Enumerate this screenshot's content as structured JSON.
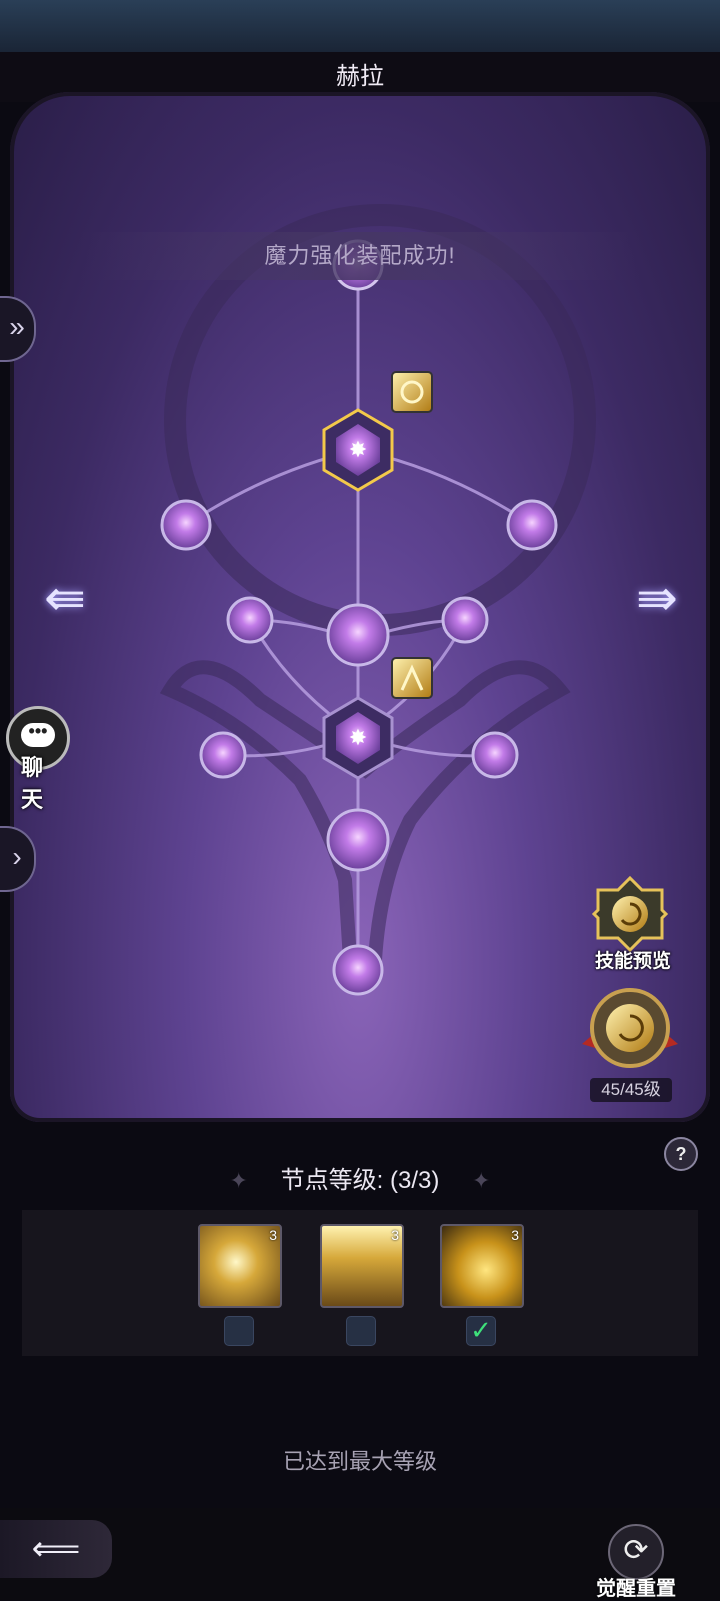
{
  "header": {
    "title": "赫拉"
  },
  "toast": {
    "message": "魔力强化装配成功!"
  },
  "side": {
    "chat_label": "聊 天",
    "chat_icon_glyph": "•••",
    "expand_top_glyph": "»",
    "expand_bottom_glyph": "›"
  },
  "nav": {
    "prev_glyph": "⇚",
    "next_glyph": "⇛"
  },
  "actions": {
    "skill_preview_label": "技能预览",
    "level_label": "45/45级",
    "help_glyph": "?"
  },
  "node": {
    "level_text": "节点等级: (3/3)",
    "star_glyph": "✦",
    "maxed_text": "已达到最大等级"
  },
  "skills": [
    {
      "name": "lightning-burst-icon",
      "level": "3",
      "selected": false
    },
    {
      "name": "light-pillar-icon",
      "level": "3",
      "selected": false
    },
    {
      "name": "golden-swirl-icon",
      "level": "3",
      "selected": true
    }
  ],
  "footer": {
    "back_glyph": "⟸",
    "reset_glyph": "⟳",
    "reset_label": "觉醒重置"
  },
  "colors": {
    "accent": "#f3c94a",
    "panel": "#5e4391",
    "node": "#c58af0"
  }
}
